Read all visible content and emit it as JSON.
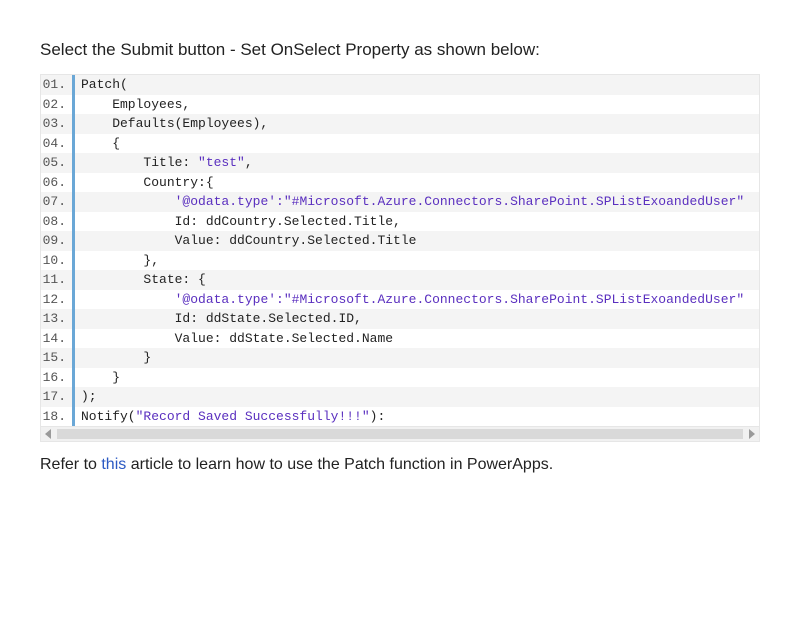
{
  "intro": "Select the Submit button - Set OnSelect Property as shown below:",
  "lines": [
    {
      "n": "01.",
      "t": [
        "Patch("
      ]
    },
    {
      "n": "02.",
      "t": [
        "    Employees,"
      ]
    },
    {
      "n": "03.",
      "t": [
        "    Defaults(Employees),"
      ]
    },
    {
      "n": "04.",
      "t": [
        "    {"
      ]
    },
    {
      "n": "05.",
      "t": [
        "        Title: ",
        {
          "s": "\"test\""
        },
        ","
      ]
    },
    {
      "n": "06.",
      "t": [
        "        Country:{"
      ]
    },
    {
      "n": "07.",
      "t": [
        "            ",
        {
          "s": "'@odata.type':\"#Microsoft.Azure.Connectors.SharePoint.SPListExoandedUser\""
        }
      ]
    },
    {
      "n": "08.",
      "t": [
        "            Id: ddCountry.Selected.Title,"
      ]
    },
    {
      "n": "09.",
      "t": [
        "            Value: ddCountry.Selected.Title"
      ]
    },
    {
      "n": "10.",
      "t": [
        "        },"
      ]
    },
    {
      "n": "11.",
      "t": [
        "        State: {"
      ]
    },
    {
      "n": "12.",
      "t": [
        "            ",
        {
          "s": "'@odata.type':\"#Microsoft.Azure.Connectors.SharePoint.SPListExoandedUser\""
        }
      ]
    },
    {
      "n": "13.",
      "t": [
        "            Id: ddState.Selected.ID,"
      ]
    },
    {
      "n": "14.",
      "t": [
        "            Value: ddState.Selected.Name"
      ]
    },
    {
      "n": "15.",
      "t": [
        "        }"
      ]
    },
    {
      "n": "16.",
      "t": [
        "    }"
      ]
    },
    {
      "n": "17.",
      "t": [
        ");"
      ]
    },
    {
      "n": "18.",
      "t": [
        "Notify(",
        {
          "s": "\"Record Saved Successfully!!!\""
        },
        "):"
      ]
    }
  ],
  "footer": {
    "pre": "Refer to ",
    "link": "this",
    "post": " article to learn how to use the Patch function in PowerApps."
  }
}
